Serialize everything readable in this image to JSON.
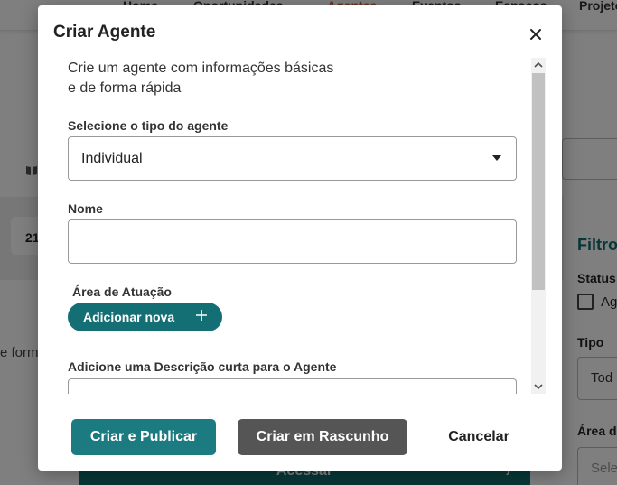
{
  "background": {
    "nav": [
      "Home",
      "Oportunidades",
      "Agentes",
      "Eventos",
      "Espaços",
      "Projetos"
    ],
    "result_count": "21",
    "description_fragment": "e form",
    "access_label": "Acessar",
    "filters": {
      "title": "Filtro",
      "status_label": "Status",
      "checkbox_label": "Ag",
      "type_label": "Tipo",
      "type_value": "Tod",
      "area_label": "Área d",
      "area_placeholder": "Sele"
    }
  },
  "modal": {
    "title": "Criar Agente",
    "intro_line1": "Crie um agente com informações básicas",
    "intro_line2": "e de forma rápida",
    "type_label": "Selecione o tipo do agente",
    "type_value": "Individual",
    "name_label": "Nome",
    "name_value": "",
    "area_label": "Área de Atuação",
    "add_button": "Adicionar nova",
    "description_label": "Adicione uma Descrição curta para o Agente",
    "description_value": ""
  },
  "footer": {
    "publish": "Criar e Publicar",
    "draft": "Criar em Rascunho",
    "cancel": "Cancelar"
  },
  "colors": {
    "primary": "#1b7b80",
    "secondary": "#555555",
    "nav_active": "#d35f32"
  }
}
